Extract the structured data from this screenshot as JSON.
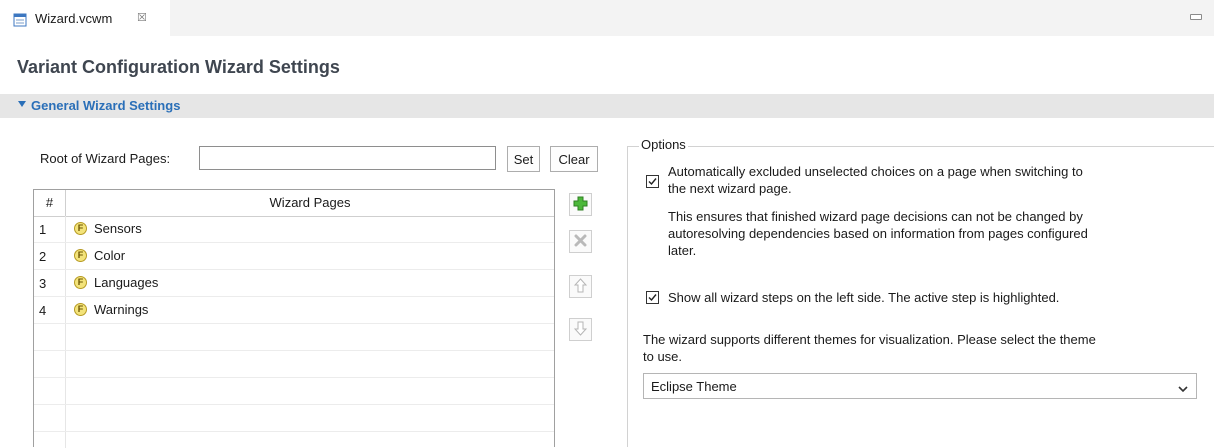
{
  "editor_tab": {
    "title": "Wizard.vcwm",
    "close": "☒"
  },
  "page_title": "Variant Configuration Wizard Settings",
  "section": {
    "title": "General Wizard Settings"
  },
  "root": {
    "label": "Root of Wizard Pages:",
    "value": "",
    "set_label": "Set",
    "clear_label": "Clear"
  },
  "table": {
    "col_num": "#",
    "col_pages": "Wizard Pages",
    "rows": [
      {
        "num": "1",
        "icon_letter": "F",
        "name": "Sensors"
      },
      {
        "num": "2",
        "icon_letter": "F",
        "name": "Color"
      },
      {
        "num": "3",
        "icon_letter": "F",
        "name": "Languages"
      },
      {
        "num": "4",
        "icon_letter": "F",
        "name": "Warnings"
      }
    ]
  },
  "side_buttons": [
    "add-icon",
    "remove-icon",
    "move-up-icon",
    "move-down-icon"
  ],
  "options": {
    "legend": "Options",
    "auto_exclude": {
      "checked": true,
      "line1": "Automatically excluded unselected choices on a page when switching to",
      "line2": "the next wizard page.",
      "note1": "This ensures that finished wizard page decisions can not be changed by",
      "note2": "autoresolving dependencies based on information from pages configured",
      "note3": "later."
    },
    "show_steps": {
      "checked": true,
      "label": "Show all wizard steps on the left side. The active step is highlighted."
    },
    "theme": {
      "text1": "The wizard supports different themes for visualization. Please select the theme",
      "text2": "to use.",
      "selected": "Eclipse Theme"
    }
  },
  "colors": {
    "accent": "#2a6fb8",
    "header_bg": "#e6e6e6",
    "add_green": "#3aa52a"
  }
}
